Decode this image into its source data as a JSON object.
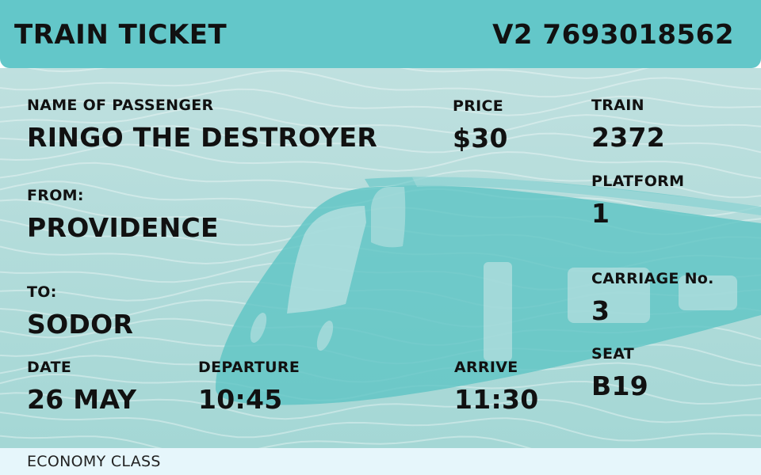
{
  "header": {
    "title": "TRAIN TICKET",
    "ticket_number": "V2 7693018562"
  },
  "passenger": {
    "label": "NAME OF PASSENGER",
    "value": "RINGO THE DESTROYER"
  },
  "from": {
    "label": "FROM:",
    "value": "PROVIDENCE"
  },
  "to": {
    "label": "TO:",
    "value": "SODOR"
  },
  "date": {
    "label": "DATE",
    "value": "26 MAY"
  },
  "departure": {
    "label": "DEPARTURE",
    "value": "10:45"
  },
  "price": {
    "label": "PRICE",
    "value": "$30"
  },
  "arrive": {
    "label": "ARRIVE",
    "value": "11:30"
  },
  "train": {
    "label": "TRAIN",
    "value": "2372"
  },
  "platform": {
    "label": "PLATFORM",
    "value": "1"
  },
  "carriage": {
    "label": "CARRIAGE No.",
    "value": "3"
  },
  "seat": {
    "label": "SEAT",
    "value": "B19"
  },
  "footer": {
    "class_label": "ECONOMY CLASS"
  },
  "colors": {
    "header": "#63c7c9",
    "body": "#b9dedd",
    "train": "#63c4c4",
    "footer": "#e6f6fb"
  }
}
